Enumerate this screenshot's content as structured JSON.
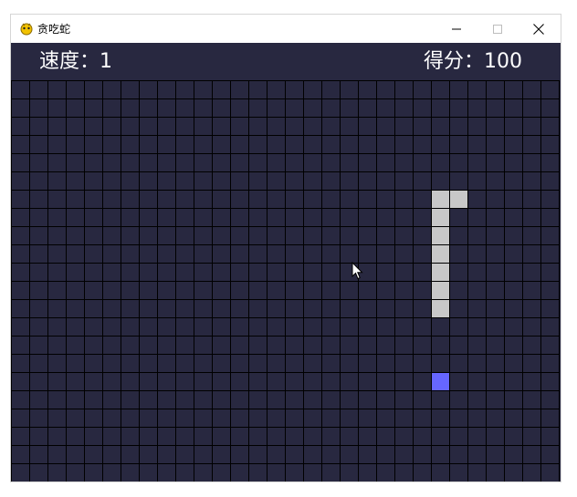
{
  "window": {
    "title": "贪吃蛇",
    "app_icon": "pygame-snake-icon",
    "controls": [
      "minimize-icon",
      "maximize-icon",
      "close-icon"
    ]
  },
  "hud": {
    "speed_text": "速度：1",
    "speed_value": 1,
    "score_text": "得分：100",
    "score_value": 100
  },
  "board": {
    "columns": 30,
    "rows": 22,
    "colors": {
      "background": "#282840",
      "grid_line": "#000000",
      "snake": "#c8c8c8",
      "food": "#6666ff"
    },
    "snake": [
      {
        "col": 23,
        "row": 6
      },
      {
        "col": 24,
        "row": 6
      },
      {
        "col": 23,
        "row": 7
      },
      {
        "col": 23,
        "row": 8
      },
      {
        "col": 23,
        "row": 9
      },
      {
        "col": 23,
        "row": 10
      },
      {
        "col": 23,
        "row": 11
      },
      {
        "col": 23,
        "row": 12
      }
    ],
    "food": {
      "col": 23,
      "row": 16
    }
  }
}
